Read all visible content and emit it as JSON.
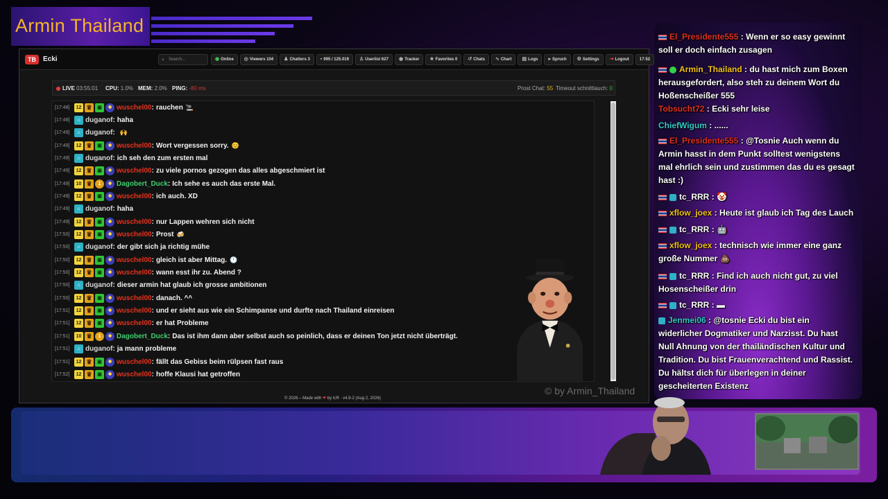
{
  "banner": {
    "title": "Armin Thailand"
  },
  "app": {
    "logo": "TB",
    "channel": "Ecki",
    "search_placeholder": "Search...",
    "nav": [
      {
        "label": "Online",
        "icon": "wifi-icon",
        "glyph": "◉"
      },
      {
        "label": "Viewers 104",
        "icon": "eye-icon",
        "glyph": "◎"
      },
      {
        "label": "Chatters 3",
        "icon": "users-icon",
        "glyph": "♟"
      },
      {
        "label": "995 / 125.019",
        "icon": "chat-icon",
        "glyph": "▪"
      },
      {
        "label": "Userlist 627",
        "icon": "user-icon",
        "glyph": "♙"
      },
      {
        "label": "Tracker",
        "icon": "target-icon",
        "glyph": "◉"
      },
      {
        "label": "Favorites 0",
        "icon": "star-icon",
        "glyph": "★"
      },
      {
        "label": "Chats",
        "icon": "history-icon",
        "glyph": "↺"
      },
      {
        "label": "Chart",
        "icon": "chart-icon",
        "glyph": "∿"
      },
      {
        "label": "Logs",
        "icon": "logs-icon",
        "glyph": "▤"
      },
      {
        "label": "Spruch",
        "icon": "quote-icon",
        "glyph": "▸"
      },
      {
        "label": "Settings",
        "icon": "gear-icon",
        "glyph": "⚙"
      },
      {
        "label": "Logout",
        "icon": "logout-icon",
        "glyph": "⇥"
      },
      {
        "label": "17:52",
        "icon": "",
        "glyph": ""
      }
    ]
  },
  "status": {
    "live_label": "LIVE",
    "uptime": "03:55:01",
    "cpu_label": "CPU:",
    "cpu": "1.0%",
    "mem_label": "MEM:",
    "mem": "2.0%",
    "ping_label": "PING:",
    "ping": "-80 ms",
    "prost_label": "Prost Chat:",
    "prost": "55",
    "timeout_label": "Timeout schnittlauch:",
    "timeout": "0"
  },
  "chat": [
    {
      "ts": "[17:48]",
      "badges": [
        "12",
        "crown",
        "gift",
        "round"
      ],
      "user": "wuschel00",
      "color": "red",
      "text": "rauchen",
      "emote": "🚬"
    },
    {
      "ts": "[17:48]",
      "badges": [
        "teal"
      ],
      "user": "duganof",
      "color": "grey",
      "text": "haha",
      "emote": ""
    },
    {
      "ts": "[17:49]",
      "badges": [
        "teal"
      ],
      "user": "duganof",
      "color": "grey",
      "text": "",
      "emote": "🙌"
    },
    {
      "ts": "[17:49]",
      "badges": [
        "12",
        "crown",
        "gift",
        "round"
      ],
      "user": "wuschel00",
      "color": "red",
      "text": "Wort vergessen sorry.",
      "emote": "😊"
    },
    {
      "ts": "[17:49]",
      "badges": [
        "teal"
      ],
      "user": "duganof",
      "color": "grey",
      "text": "ich seh den zum ersten mal",
      "emote": ""
    },
    {
      "ts": "[17:49]",
      "badges": [
        "12",
        "crown",
        "gift",
        "round"
      ],
      "user": "wuschel00",
      "color": "red",
      "text": "zu viele pornos gezogen das alles abgeschmiert ist",
      "emote": ""
    },
    {
      "ts": "[17:49]",
      "badges": [
        "10",
        "crown",
        "coin",
        "round"
      ],
      "user": "Dagobert_Duck",
      "color": "green",
      "text": "Ich sehe es auch das erste Mal.",
      "emote": ""
    },
    {
      "ts": "[17:49]",
      "badges": [
        "12",
        "crown",
        "gift",
        "round"
      ],
      "user": "wuschel00",
      "color": "red",
      "text": "ich auch. XD",
      "emote": ""
    },
    {
      "ts": "[17:49]",
      "badges": [
        "teal"
      ],
      "user": "duganof",
      "color": "grey",
      "text": "haha",
      "emote": ""
    },
    {
      "ts": "[17:49]",
      "badges": [
        "12",
        "crown",
        "gift",
        "round"
      ],
      "user": "wuschel00",
      "color": "red",
      "text": "nur Lappen wehren sich nicht",
      "emote": ""
    },
    {
      "ts": "[17:50]",
      "badges": [
        "12",
        "crown",
        "gift",
        "round"
      ],
      "user": "wuschel00",
      "color": "red",
      "text": "Prost",
      "emote": "🍻"
    },
    {
      "ts": "[17:50]",
      "badges": [
        "teal"
      ],
      "user": "duganof",
      "color": "grey",
      "text": "der gibt sich ja richtig mühe",
      "emote": ""
    },
    {
      "ts": "[17:50]",
      "badges": [
        "12",
        "crown",
        "gift",
        "round"
      ],
      "user": "wuschel00",
      "color": "red",
      "text": "gleich ist aber Mittag.",
      "emote": "🕛"
    },
    {
      "ts": "[17:50]",
      "badges": [
        "12",
        "crown",
        "gift",
        "round"
      ],
      "user": "wuschel00",
      "color": "red",
      "text": "wann esst ihr zu. Abend ?",
      "emote": ""
    },
    {
      "ts": "[17:50]",
      "badges": [
        "teal"
      ],
      "user": "duganof",
      "color": "grey",
      "text": "dieser armin hat glaub ich grosse ambitionen",
      "emote": ""
    },
    {
      "ts": "[17:50]",
      "badges": [
        "12",
        "crown",
        "gift",
        "round"
      ],
      "user": "wuschel00",
      "color": "red",
      "text": "danach. ^^",
      "emote": ""
    },
    {
      "ts": "[17:51]",
      "badges": [
        "12",
        "crown",
        "gift",
        "round"
      ],
      "user": "wuschel00",
      "color": "red",
      "text": "und er sieht aus wie ein Schimpanse und durfte nach Thailand einreisen",
      "emote": ""
    },
    {
      "ts": "[17:51]",
      "badges": [
        "12",
        "crown",
        "gift",
        "round"
      ],
      "user": "wuschel00",
      "color": "red",
      "text": "er hat Probleme",
      "emote": ""
    },
    {
      "ts": "[17:51]",
      "badges": [
        "10",
        "crown",
        "coin",
        "round"
      ],
      "user": "Dagobert_Duck",
      "color": "green",
      "text": "Das ist ihm dann aber selbst auch so peinlich, dass er deinen Ton jetzt nicht überträgt.",
      "emote": ""
    },
    {
      "ts": "[17:51]",
      "badges": [
        "teal"
      ],
      "user": "duganof",
      "color": "grey",
      "text": "ja mann probleme",
      "emote": ""
    },
    {
      "ts": "[17:51]",
      "badges": [
        "12",
        "crown",
        "gift",
        "round"
      ],
      "user": "wuschel00",
      "color": "red",
      "text": "fällt das Gebiss beim rülpsen fast raus",
      "emote": ""
    },
    {
      "ts": "[17:52]",
      "badges": [
        "12",
        "crown",
        "gift",
        "round"
      ],
      "user": "wuschel00",
      "color": "red",
      "text": "hoffe Klausi hat getroffen",
      "emote": ""
    }
  ],
  "watermark": "© by Armin_Thailand",
  "footer": {
    "pre": "© 2026 – Made with",
    "post": "by tcR · v4.9-2 (Aug 2, 2026)"
  },
  "overlay": [
    {
      "badge": "flag",
      "user": "El_Presidente555",
      "color": "red",
      "text": ": Wenn er so easy gewinnt soll er doch einfach zusagen"
    },
    {
      "badge": "flag gem",
      "user": "Armin_Thailand",
      "color": "yellow",
      "text": ": du hast mich zum Boxen herausgefordert, also steh zu deinem Wort du Hoßenscheißer 555"
    },
    {
      "badge": "",
      "user": "Tobsucht72",
      "color": "red",
      "text": ": Ecki sehr leise"
    },
    {
      "badge": "",
      "user": "ChiefWigum",
      "color": "teal",
      "text": ": ......"
    },
    {
      "badge": "flag",
      "user": "El_Presidente555",
      "color": "red",
      "text": ": @Tosnie Auch wenn du Armin hasst in dem Punkt solltest wenigstens mal ehrlich sein und zustimmen das du es gesagt hast :)"
    },
    {
      "badge": "flag teal",
      "user": "tc_RRR",
      "color": "white",
      "text": ": 🤡"
    },
    {
      "badge": "flag",
      "user": "xflow_joex",
      "color": "yellow",
      "text": ": Heute ist glaub ich Tag des Lauch"
    },
    {
      "badge": "flag teal",
      "user": "tc_RRR",
      "color": "white",
      "text": ": 🤖"
    },
    {
      "badge": "flag",
      "user": "xflow_joex",
      "color": "yellow",
      "text": ": technisch wie immer eine ganz große Nummer 💩"
    },
    {
      "badge": "flag teal",
      "user": "tc_RRR",
      "color": "white",
      "text": ": Find ich auch nicht gut, zu viel Hosenscheißer drin"
    },
    {
      "badge": "flag teal",
      "user": "tc_RRR",
      "color": "white",
      "text": ": ▬"
    },
    {
      "badge": "teal",
      "user": "Jenmei06",
      "color": "teal",
      "text": ": @tosnie Ecki du bist ein widerlicher Dogmatiker und Narzisst. Du hast Null Ahnung von der thailändischen Kultur und Tradition. Du bist Frauenverachtend und Rassist. Du hältst dich für überlegen in deiner gescheiterten Existenz"
    }
  ]
}
